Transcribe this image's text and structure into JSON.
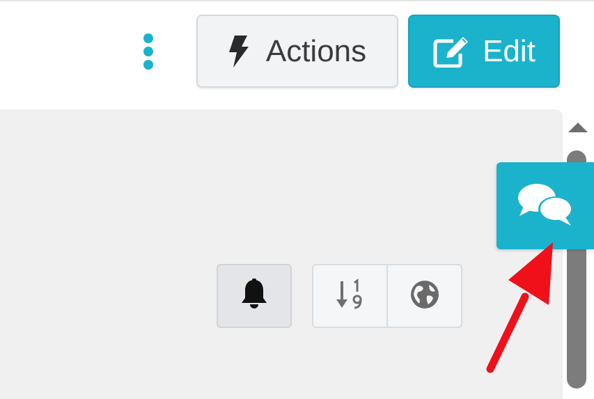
{
  "toolbar": {
    "actions_label": "Actions",
    "edit_label": "Edit",
    "more_icon": "vertical-ellipsis-icon",
    "actions_icon": "lightning-bolt-icon",
    "edit_icon": "pencil-square-icon"
  },
  "panel": {
    "notification_icon": "bell-icon",
    "sort_icon": "sort-numeric-icon",
    "globe_icon": "globe-icon"
  },
  "chat": {
    "icon": "chat-bubbles-icon"
  },
  "colors": {
    "accent": "#1ab3cb",
    "panel_bg": "#f0f0f0",
    "annotation_arrow": "#f0101a"
  }
}
